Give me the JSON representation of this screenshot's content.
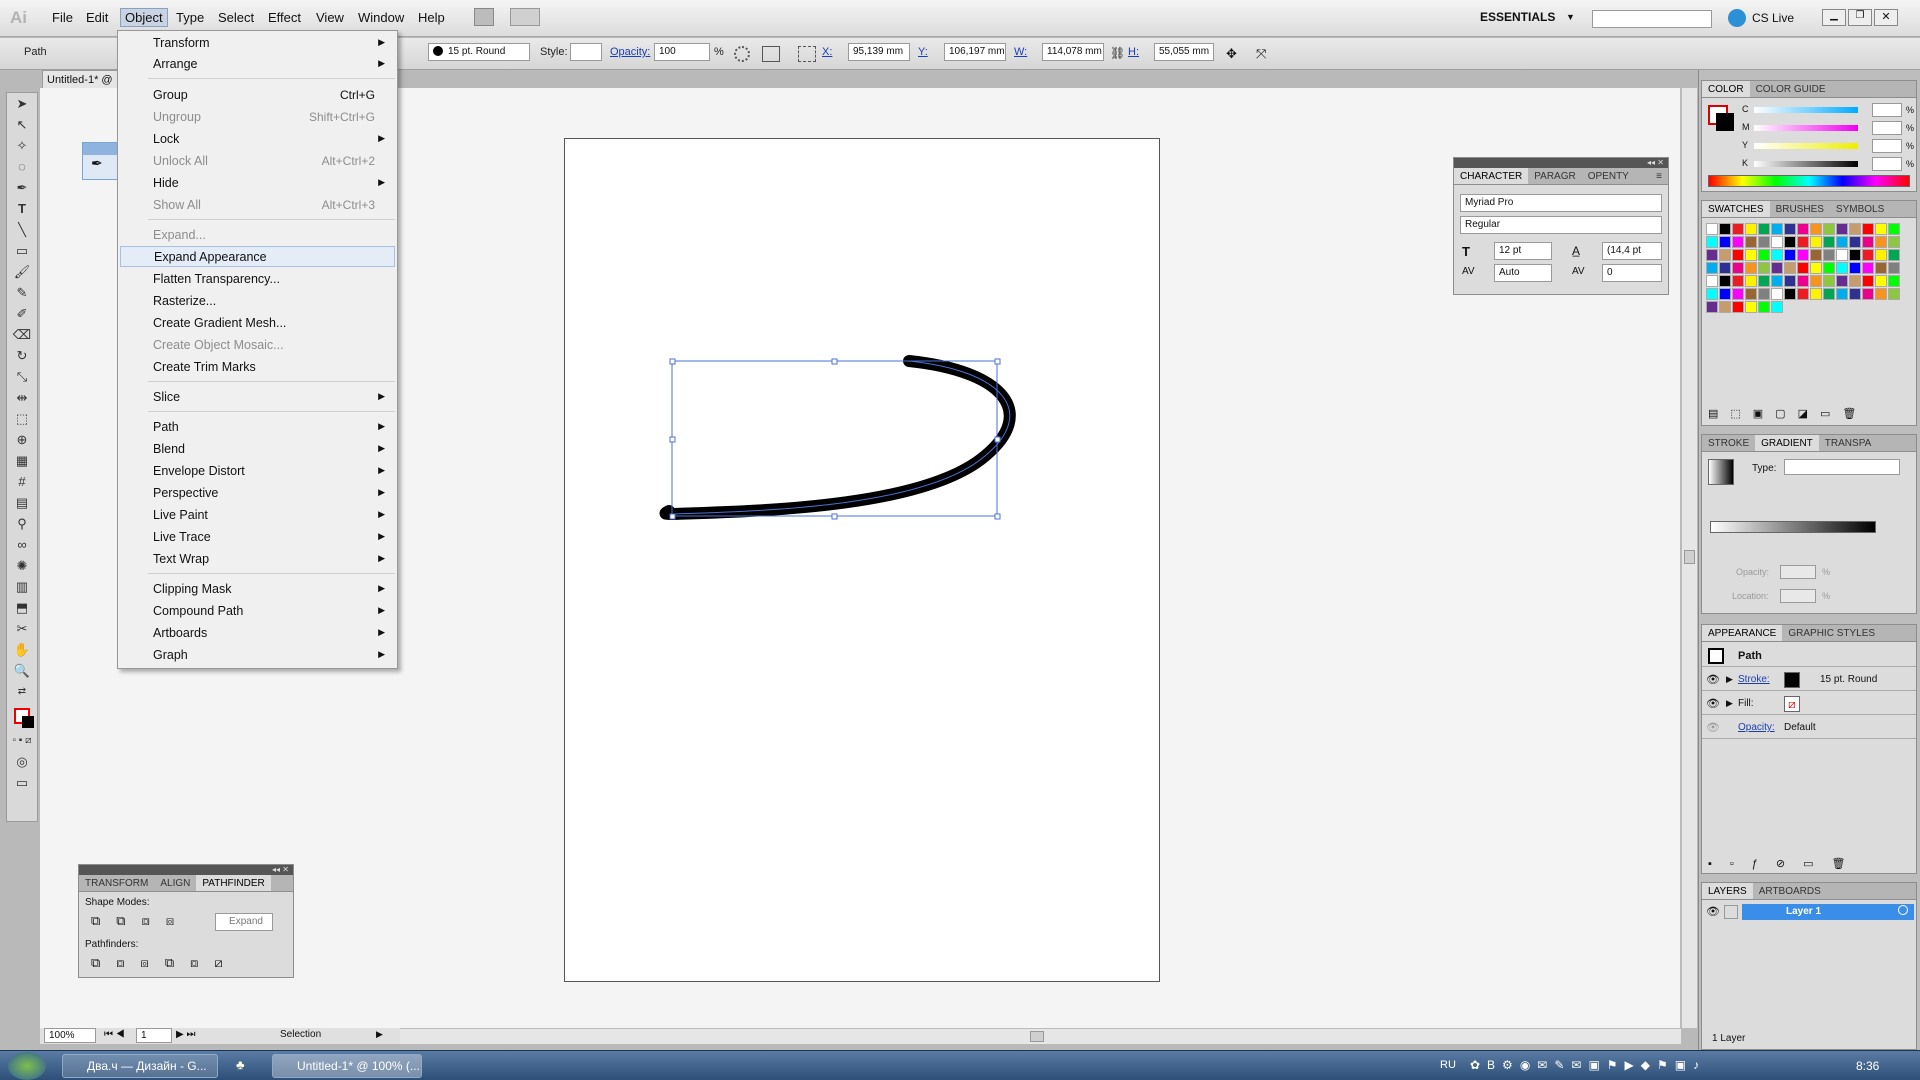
{
  "menubar": {
    "logo": "Ai",
    "items": [
      "File",
      "Edit",
      "Object",
      "Type",
      "Select",
      "Effect",
      "View",
      "Window",
      "Help"
    ],
    "workspace": "ESSENTIALS",
    "cs_live": "CS Live"
  },
  "control": {
    "selection_type": "Path",
    "stroke_weight": "15 pt. Round",
    "style_label": "Style:",
    "opacity_label": "Opacity:",
    "opacity_value": "100",
    "opacity_unit": "%",
    "x_label": "X:",
    "x_value": "95,139 mm",
    "y_label": "Y:",
    "y_value": "106,197 mm",
    "w_label": "W:",
    "w_value": "114,078 mm",
    "h_label": "H:",
    "h_value": "55,055 mm"
  },
  "document": {
    "tab_title": "Untitled-1* @"
  },
  "object_menu": {
    "items": [
      {
        "label": "Transform",
        "arrow": true
      },
      {
        "label": "Arrange",
        "arrow": true
      },
      {
        "label": "Group",
        "shortcut": "Ctrl+G"
      },
      {
        "label": "Ungroup",
        "shortcut": "Shift+Ctrl+G",
        "disabled": true
      },
      {
        "label": "Lock",
        "arrow": true
      },
      {
        "label": "Unlock All",
        "shortcut": "Alt+Ctrl+2",
        "disabled": true
      },
      {
        "label": "Hide",
        "arrow": true
      },
      {
        "label": "Show All",
        "shortcut": "Alt+Ctrl+3",
        "disabled": true
      },
      {
        "label": "Expand...",
        "disabled": true
      },
      {
        "label": "Expand Appearance",
        "highlighted": true
      },
      {
        "label": "Flatten Transparency..."
      },
      {
        "label": "Rasterize..."
      },
      {
        "label": "Create Gradient Mesh..."
      },
      {
        "label": "Create Object Mosaic...",
        "disabled": true
      },
      {
        "label": "Create Trim Marks"
      },
      {
        "label": "Slice",
        "arrow": true
      },
      {
        "label": "Path",
        "arrow": true
      },
      {
        "label": "Blend",
        "arrow": true
      },
      {
        "label": "Envelope Distort",
        "arrow": true
      },
      {
        "label": "Perspective",
        "arrow": true
      },
      {
        "label": "Live Paint",
        "arrow": true
      },
      {
        "label": "Live Trace",
        "arrow": true
      },
      {
        "label": "Text Wrap",
        "arrow": true
      },
      {
        "label": "Clipping Mask",
        "arrow": true
      },
      {
        "label": "Compound Path",
        "arrow": true
      },
      {
        "label": "Artboards",
        "arrow": true
      },
      {
        "label": "Graph",
        "arrow": true
      }
    ]
  },
  "character_panel": {
    "tabs": [
      "CHARACTER",
      "PARAGR",
      "OPENTY"
    ],
    "font": "Myriad Pro",
    "style": "Regular",
    "size": "12 pt",
    "leading": "(14,4 pt",
    "kerning": "Auto",
    "tracking": "0"
  },
  "color_panel": {
    "tabs": [
      "COLOR",
      "COLOR GUIDE"
    ],
    "channels": [
      "C",
      "M",
      "Y",
      "K"
    ],
    "unit": "%"
  },
  "swatches_panel": {
    "tabs": [
      "SWATCHES",
      "BRUSHES",
      "SYMBOLS"
    ]
  },
  "gradient_panel": {
    "tabs": [
      "STROKE",
      "GRADIENT",
      "TRANSPA"
    ],
    "type_label": "Type:",
    "opacity_label": "Opacity:",
    "location_label": "Location:",
    "unit": "%"
  },
  "appearance_panel": {
    "tabs": [
      "APPEARANCE",
      "GRAPHIC STYLES"
    ],
    "title": "Path",
    "stroke_label": "Stroke:",
    "stroke_value": "15 pt. Round",
    "fill_label": "Fill:",
    "opacity_label": "Opacity:",
    "opacity_value": "Default"
  },
  "layers_panel": {
    "tabs": [
      "LAYERS",
      "ARTBOARDS"
    ],
    "layer_name": "Layer 1",
    "footer": "1 Layer"
  },
  "pathfinder_panel": {
    "tabs": [
      "TRANSFORM",
      "ALIGN",
      "PATHFINDER"
    ],
    "shape_modes": "Shape Modes:",
    "expand": "Expand",
    "pathfinders": "Pathfinders:"
  },
  "status": {
    "zoom": "100%",
    "artboard": "1",
    "tool": "Selection"
  },
  "taskbar": {
    "task1": "Два.ч — Дизайн - G...",
    "task2": "Untitled-1* @ 100% (...",
    "lang": "RU",
    "time": "8:36"
  },
  "swatch_colors": [
    "#ffffff",
    "#000000",
    "#ed1c24",
    "#fff200",
    "#00a651",
    "#00aeef",
    "#2e3192",
    "#ec008c",
    "#f7941d",
    "#8dc63f",
    "#662d91",
    "#c69c6d",
    "#ff0000",
    "#ffff00",
    "#00ff00",
    "#00ffff",
    "#0000ff",
    "#ff00ff",
    "#996633",
    "#808080"
  ]
}
